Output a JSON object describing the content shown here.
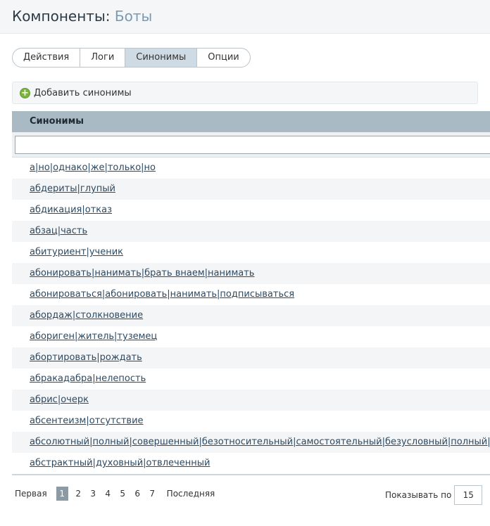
{
  "header": {
    "title": "Компоненты:",
    "section": "Боты"
  },
  "tabs": [
    {
      "label": "Действия"
    },
    {
      "label": "Логи"
    },
    {
      "label": "Синонимы"
    },
    {
      "label": "Опции"
    }
  ],
  "toolbar": {
    "add_label": "Добавить синонимы",
    "add_icon": "plus-circle-icon"
  },
  "grid": {
    "column": "Синонимы",
    "filter_value": "",
    "rows": [
      "а|но|однако|же|только|но",
      "абдериты|глупый",
      "абдикация|отказ",
      "абзац|часть",
      "абитуриент|ученик",
      "абонировать|нанимать|брать внаем|нанимать",
      "абонироваться|абонировать|нанимать|подписываться",
      "абордаж|столкновение",
      "абориген|житель|туземец",
      "абортировать|рождать",
      "абракадабра|нелепость",
      "абрис|очерк",
      "абсентеизм|отсутствие",
      "абсолютный|полный|совершенный|безотносительный|самостоятельный|безусловный|полный|са",
      "абстрактный|духовный|отвлеченный"
    ]
  },
  "pager": {
    "first": "Первая",
    "pages": [
      "1",
      "2",
      "3",
      "4",
      "5",
      "6",
      "7"
    ],
    "current": "1",
    "last": "Последняя",
    "per_page_label": "Показывать по",
    "per_page_value": "15"
  }
}
